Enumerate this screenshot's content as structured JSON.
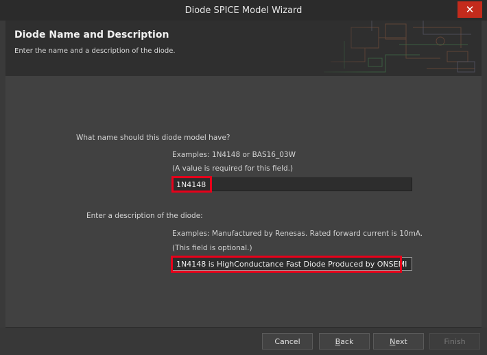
{
  "window": {
    "title": "Diode SPICE Model Wizard",
    "close_glyph": "✕"
  },
  "header": {
    "title": "Diode Name and Description",
    "subtitle": "Enter the name and a description of the diode."
  },
  "name_section": {
    "question": "What name should this diode model have?",
    "examples": "Examples: 1N4148 or BAS16_03W",
    "note": "(A value is required for this field.)",
    "value": "1N4148"
  },
  "desc_section": {
    "question": "Enter a description of the diode:",
    "examples": "Examples: Manufactured by Renesas. Rated forward current is 10mA.",
    "note": "(This field is optional.)",
    "value": "1N4148 is HighConductance Fast Diode Produced by ONSEMI"
  },
  "buttons": {
    "cancel": "Cancel",
    "back_mnemonic": "B",
    "back_rest": "ack",
    "next_mnemonic": "N",
    "next_rest": "ext",
    "finish": "Finish"
  },
  "colors": {
    "highlight": "#e8001a",
    "close": "#c42b1c"
  }
}
